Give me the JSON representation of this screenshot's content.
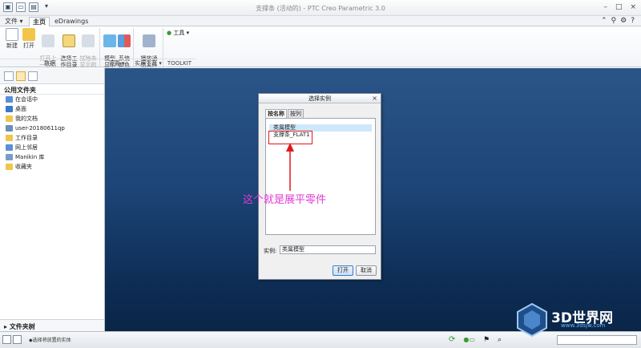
{
  "app": {
    "title": "支撑条 (活动的) - PTC Creo Parametric 3.0"
  },
  "tabs": [
    {
      "label": "文件",
      "dropdown": true
    },
    {
      "label": "主页",
      "active": true
    },
    {
      "label": "eDrawings"
    }
  ],
  "ribbon": {
    "buttons": [
      {
        "label": "新建",
        "color": "#ffffff"
      },
      {
        "label": "打开",
        "color": "#f3c44a"
      },
      {
        "label": "打开上\n一会话",
        "color": "#d7dde6"
      },
      {
        "label": "选择工\n作目录",
        "color": "#f3d77a"
      },
      {
        "label": "拭除未\n显示的",
        "color": "#d7dde6"
      },
      {
        "label": "模型\n显示",
        "color": "#6ab6e8"
      },
      {
        "label": "系统\n颜色",
        "color": "#5a9de0"
      },
      {
        "label": "播放通\n信文件",
        "color": "#9fb4cc"
      }
    ],
    "tools_menu": "工具",
    "groups": [
      "数据",
      "设置",
      "实用工具",
      "TOOLKIT"
    ]
  },
  "left_panel": {
    "header": "公用文件夹",
    "items": [
      {
        "label": "在会话中",
        "color": "#5a8fd6"
      },
      {
        "label": "桌面",
        "color": "#3b78c9"
      },
      {
        "label": "我的文档",
        "color": "#f0c54b"
      },
      {
        "label": "user-20180611qp",
        "color": "#6a8fb8"
      },
      {
        "label": "工作目录",
        "color": "#f0c54b"
      },
      {
        "label": "网上邻居",
        "color": "#5a8fd6"
      },
      {
        "label": "Manikin 库",
        "color": "#7a9bc6"
      },
      {
        "label": "收藏夹",
        "color": "#f0c54b"
      }
    ],
    "footer": "文件夹树"
  },
  "dialog": {
    "title": "选择实例",
    "close": "×",
    "tabs": [
      "按名称",
      "按列"
    ],
    "rows": [
      "类属模型",
      "支撑条_FLAT1"
    ],
    "instance_label": "实例:",
    "instance_value": "类属模型",
    "open_label": "打开",
    "cancel_label": "取消"
  },
  "annotation": {
    "text": "这个就是展平零件",
    "color": "#e23ad3",
    "box_color": "#e0191e"
  },
  "status": {
    "message": "◆选择将放置的实体"
  },
  "watermark": {
    "brand": "3D世界网",
    "url": "www.3dsjw.com"
  }
}
